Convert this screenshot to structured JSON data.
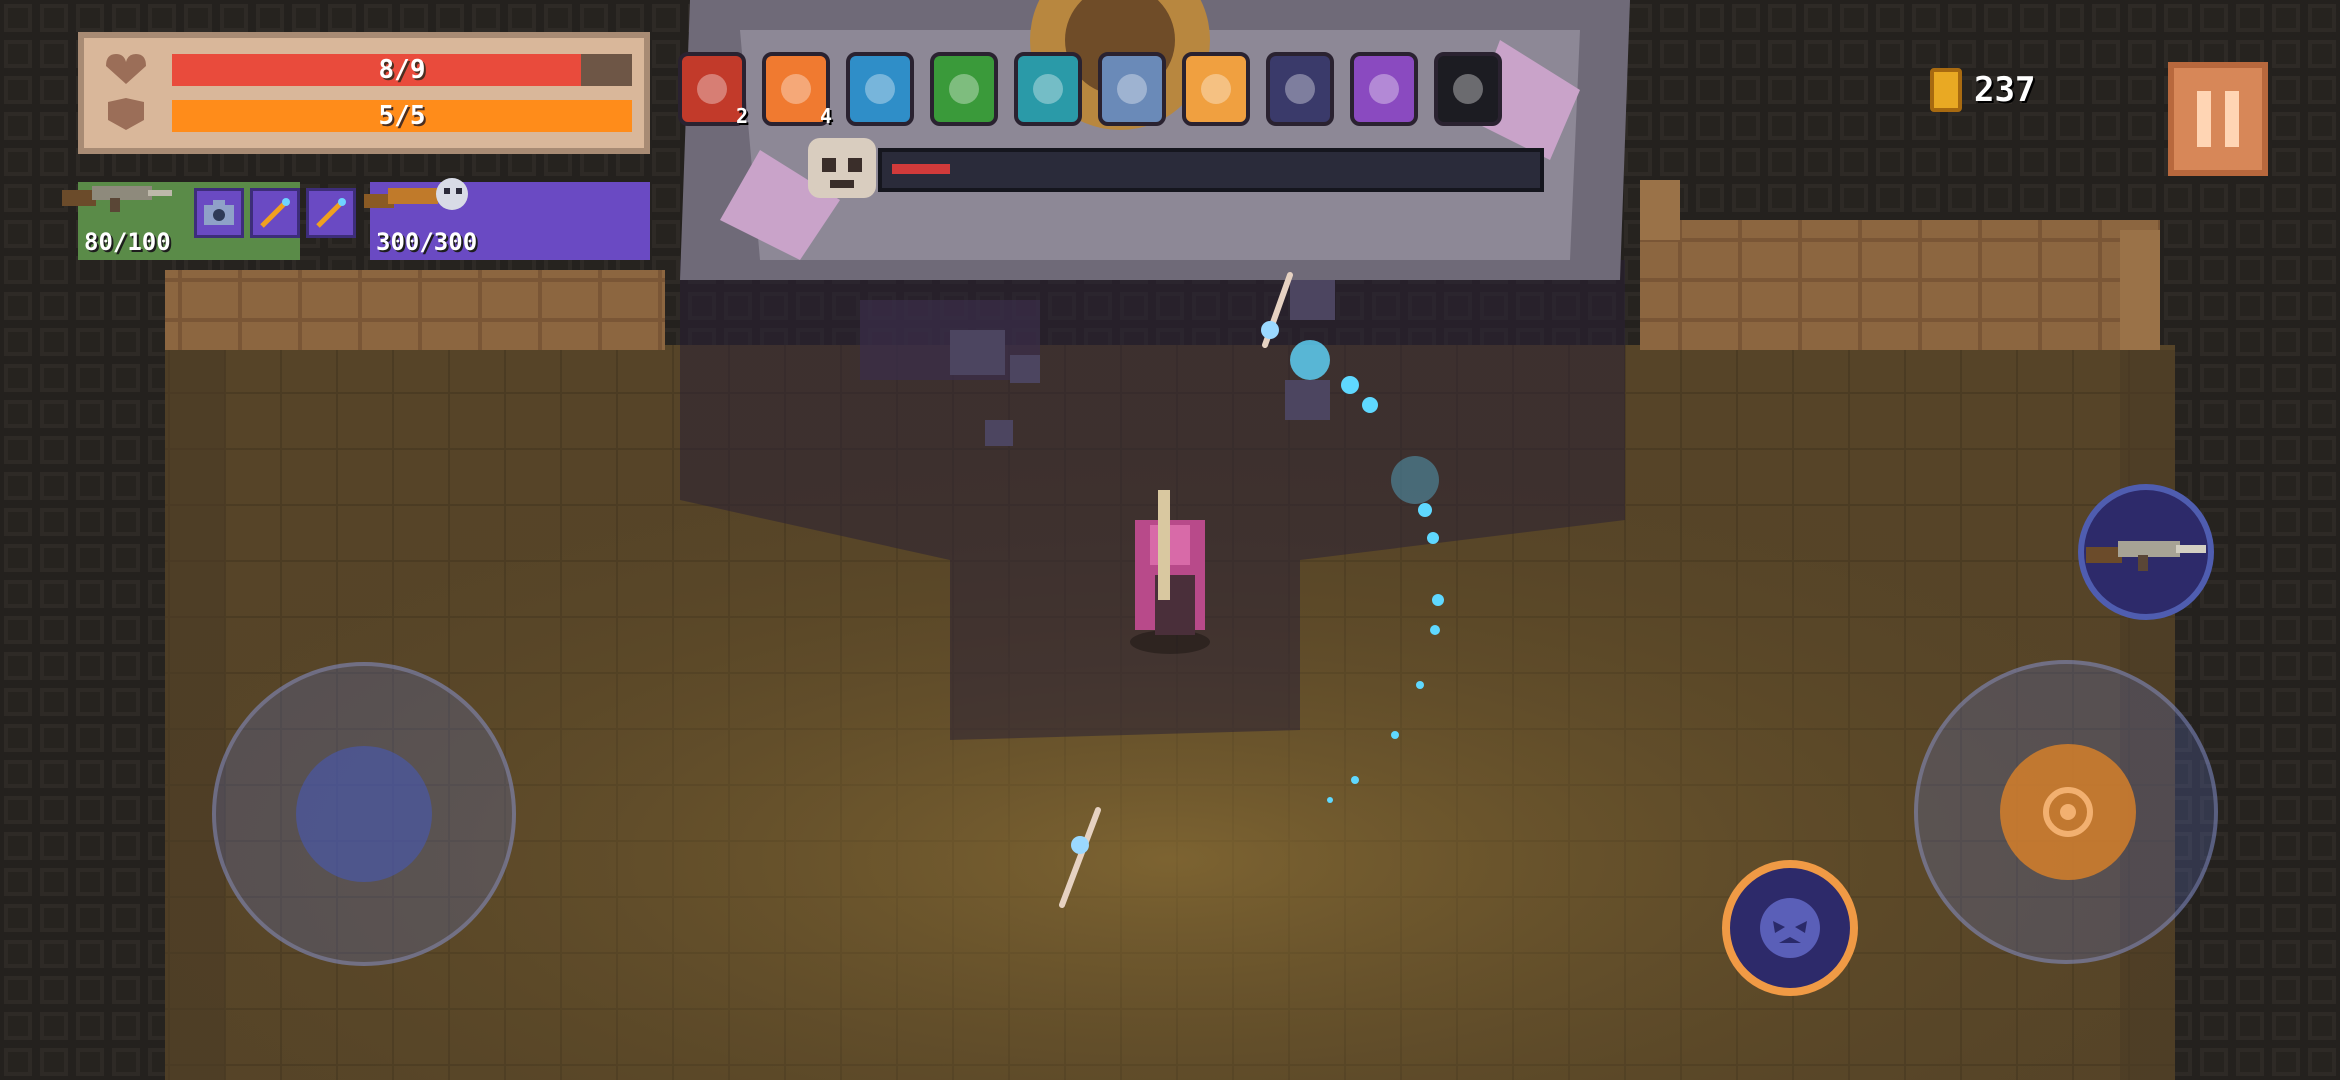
{
  "hud": {
    "health": {
      "text": "8/9",
      "fill": 0.889,
      "color": "#e94b3c"
    },
    "armor": {
      "text": "5/5",
      "fill": 1.0,
      "color": "#ff8c1a"
    },
    "primary_weapon": {
      "ammo": "80/100",
      "icon": "rifle-icon"
    },
    "secondary_weapon": {
      "ammo": "300/300",
      "icon": "skull-gun-icon"
    },
    "chips": [
      "camera-chip-icon",
      "staff-chip-icon",
      "staff-chip-icon"
    ],
    "coins": "237"
  },
  "buffs": [
    {
      "name": "red-blade-buff-icon",
      "count": "2"
    },
    {
      "name": "flame-buff-icon",
      "count": "4"
    },
    {
      "name": "ice-tome-buff-icon",
      "count": ""
    },
    {
      "name": "green-gem-buff-icon",
      "count": ""
    },
    {
      "name": "blade-tome-buff-icon",
      "count": ""
    },
    {
      "name": "wind-orb-buff-icon",
      "count": ""
    },
    {
      "name": "orange-helmet-buff-icon",
      "count": ""
    },
    {
      "name": "dark-mask-buff-icon",
      "count": ""
    },
    {
      "name": "purple-shell-buff-icon",
      "count": ""
    },
    {
      "name": "black-orb-buff-icon",
      "count": ""
    }
  ],
  "boss": {
    "health_fill": 0.09,
    "icon": "skull-icon"
  },
  "controls": {
    "move_joystick": "move-joystick",
    "aim_joystick": "aim-joystick",
    "weapon_swap": "rifle-swap-icon",
    "skill": "skill-demon-icon",
    "pause": "pause-icon"
  },
  "colors": {
    "floor": "#5a4a2c",
    "wall": "#2b2622",
    "health": "#e94b3c",
    "armor": "#ff8c1a",
    "primary_panel": "#5a8b48",
    "secondary_panel": "#6a4ac3",
    "skill_ring": "#f09a45"
  }
}
